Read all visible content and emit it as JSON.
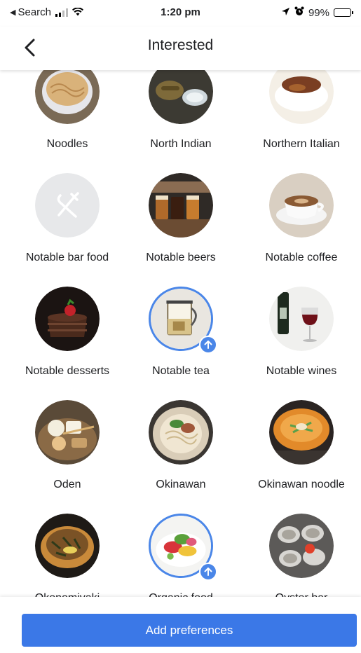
{
  "status_bar": {
    "back_app": "Search",
    "time": "1:20 pm",
    "battery_percent": "99%",
    "battery_level": 0.99
  },
  "header": {
    "title": "Interested"
  },
  "accent_color": "#4a86e8",
  "items": [
    {
      "label": "Noodles",
      "icon": "noodles-photo",
      "selected": false
    },
    {
      "label": "North Indian",
      "icon": "north-indian-photo",
      "selected": false
    },
    {
      "label": "Northern Italian",
      "icon": "northern-italian-photo",
      "selected": false
    },
    {
      "label": "Notable bar food",
      "icon": "fork-knife-placeholder-icon",
      "selected": false
    },
    {
      "label": "Notable beers",
      "icon": "beer-flight-photo",
      "selected": false
    },
    {
      "label": "Notable coffee",
      "icon": "coffee-cup-photo",
      "selected": false
    },
    {
      "label": "Notable desserts",
      "icon": "chocolate-cake-photo",
      "selected": false
    },
    {
      "label": "Notable tea",
      "icon": "tea-press-photo",
      "selected": true
    },
    {
      "label": "Notable wines",
      "icon": "red-wine-photo",
      "selected": false
    },
    {
      "label": "Oden",
      "icon": "oden-photo",
      "selected": false
    },
    {
      "label": "Okinawan",
      "icon": "okinawan-noodle-bowl-photo",
      "selected": false
    },
    {
      "label": "Okinawan noodle",
      "icon": "okinawan-ramen-photo",
      "selected": false
    },
    {
      "label": "Okonomiyaki",
      "icon": "okonomiyaki-photo",
      "selected": false
    },
    {
      "label": "Organic food",
      "icon": "organic-salad-photo",
      "selected": true
    },
    {
      "label": "Oyster bar",
      "icon": "oysters-photo",
      "selected": false
    }
  ],
  "footer": {
    "button_label": "Add preferences"
  }
}
